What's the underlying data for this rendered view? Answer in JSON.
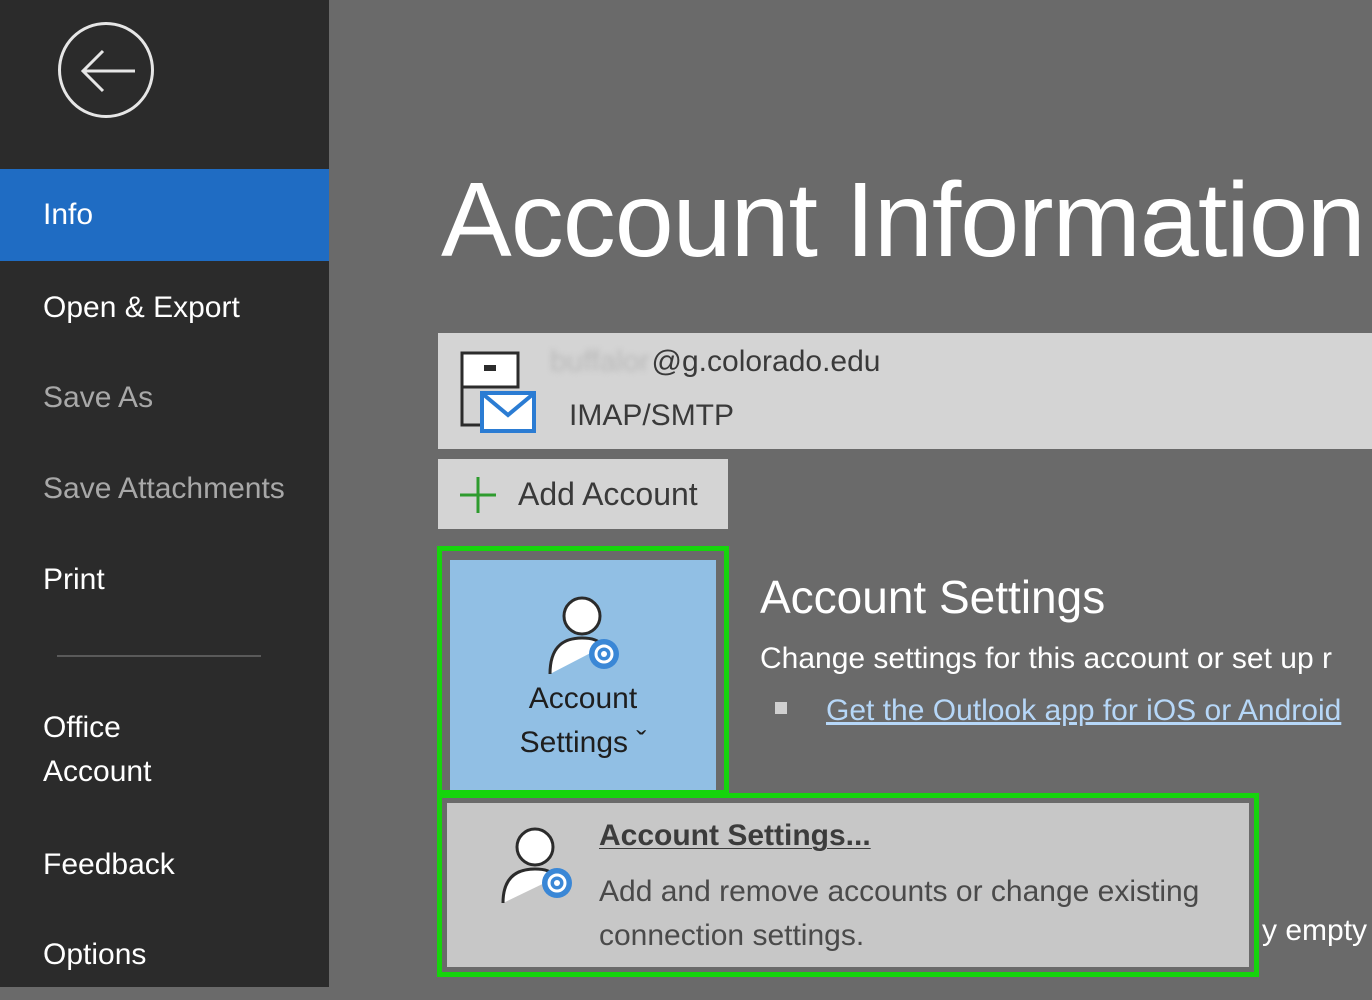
{
  "sidebar": {
    "back_icon": "back-arrow-icon",
    "items": [
      {
        "label": "Info",
        "state": "active"
      },
      {
        "label": "Open & Export",
        "state": "normal"
      },
      {
        "label": "Save As",
        "state": "disabled"
      },
      {
        "label": "Save Attachments",
        "state": "disabled"
      },
      {
        "label": "Print",
        "state": "normal"
      },
      {
        "label": "Office\nAccount",
        "state": "normal"
      },
      {
        "label": "Feedback",
        "state": "normal"
      },
      {
        "label": "Options",
        "state": "normal"
      }
    ]
  },
  "main": {
    "title": "Account Information",
    "account": {
      "email_user": "buffalor",
      "email_domain": "@g.colorado.edu",
      "type": "IMAP/SMTP",
      "icon": "mail-account-icon"
    },
    "add_account_label": "Add Account",
    "account_settings": {
      "button_line1": "Account",
      "button_line2": "Settings ˇ",
      "section_title": "Account Settings",
      "description": "Change settings for this account or set up r",
      "link": "Get the Outlook app for iOS or Android"
    },
    "partial_text": "y empty",
    "dropdown": {
      "title": "Account Settings...",
      "description": "Add and remove accounts or change existing connection settings."
    }
  },
  "colors": {
    "sidebar_bg": "#2b2b2b",
    "active_item": "#1f6cc3",
    "main_bg": "#6a6a6a",
    "highlight": "#16d40c",
    "button_blue": "#91bfe4"
  }
}
